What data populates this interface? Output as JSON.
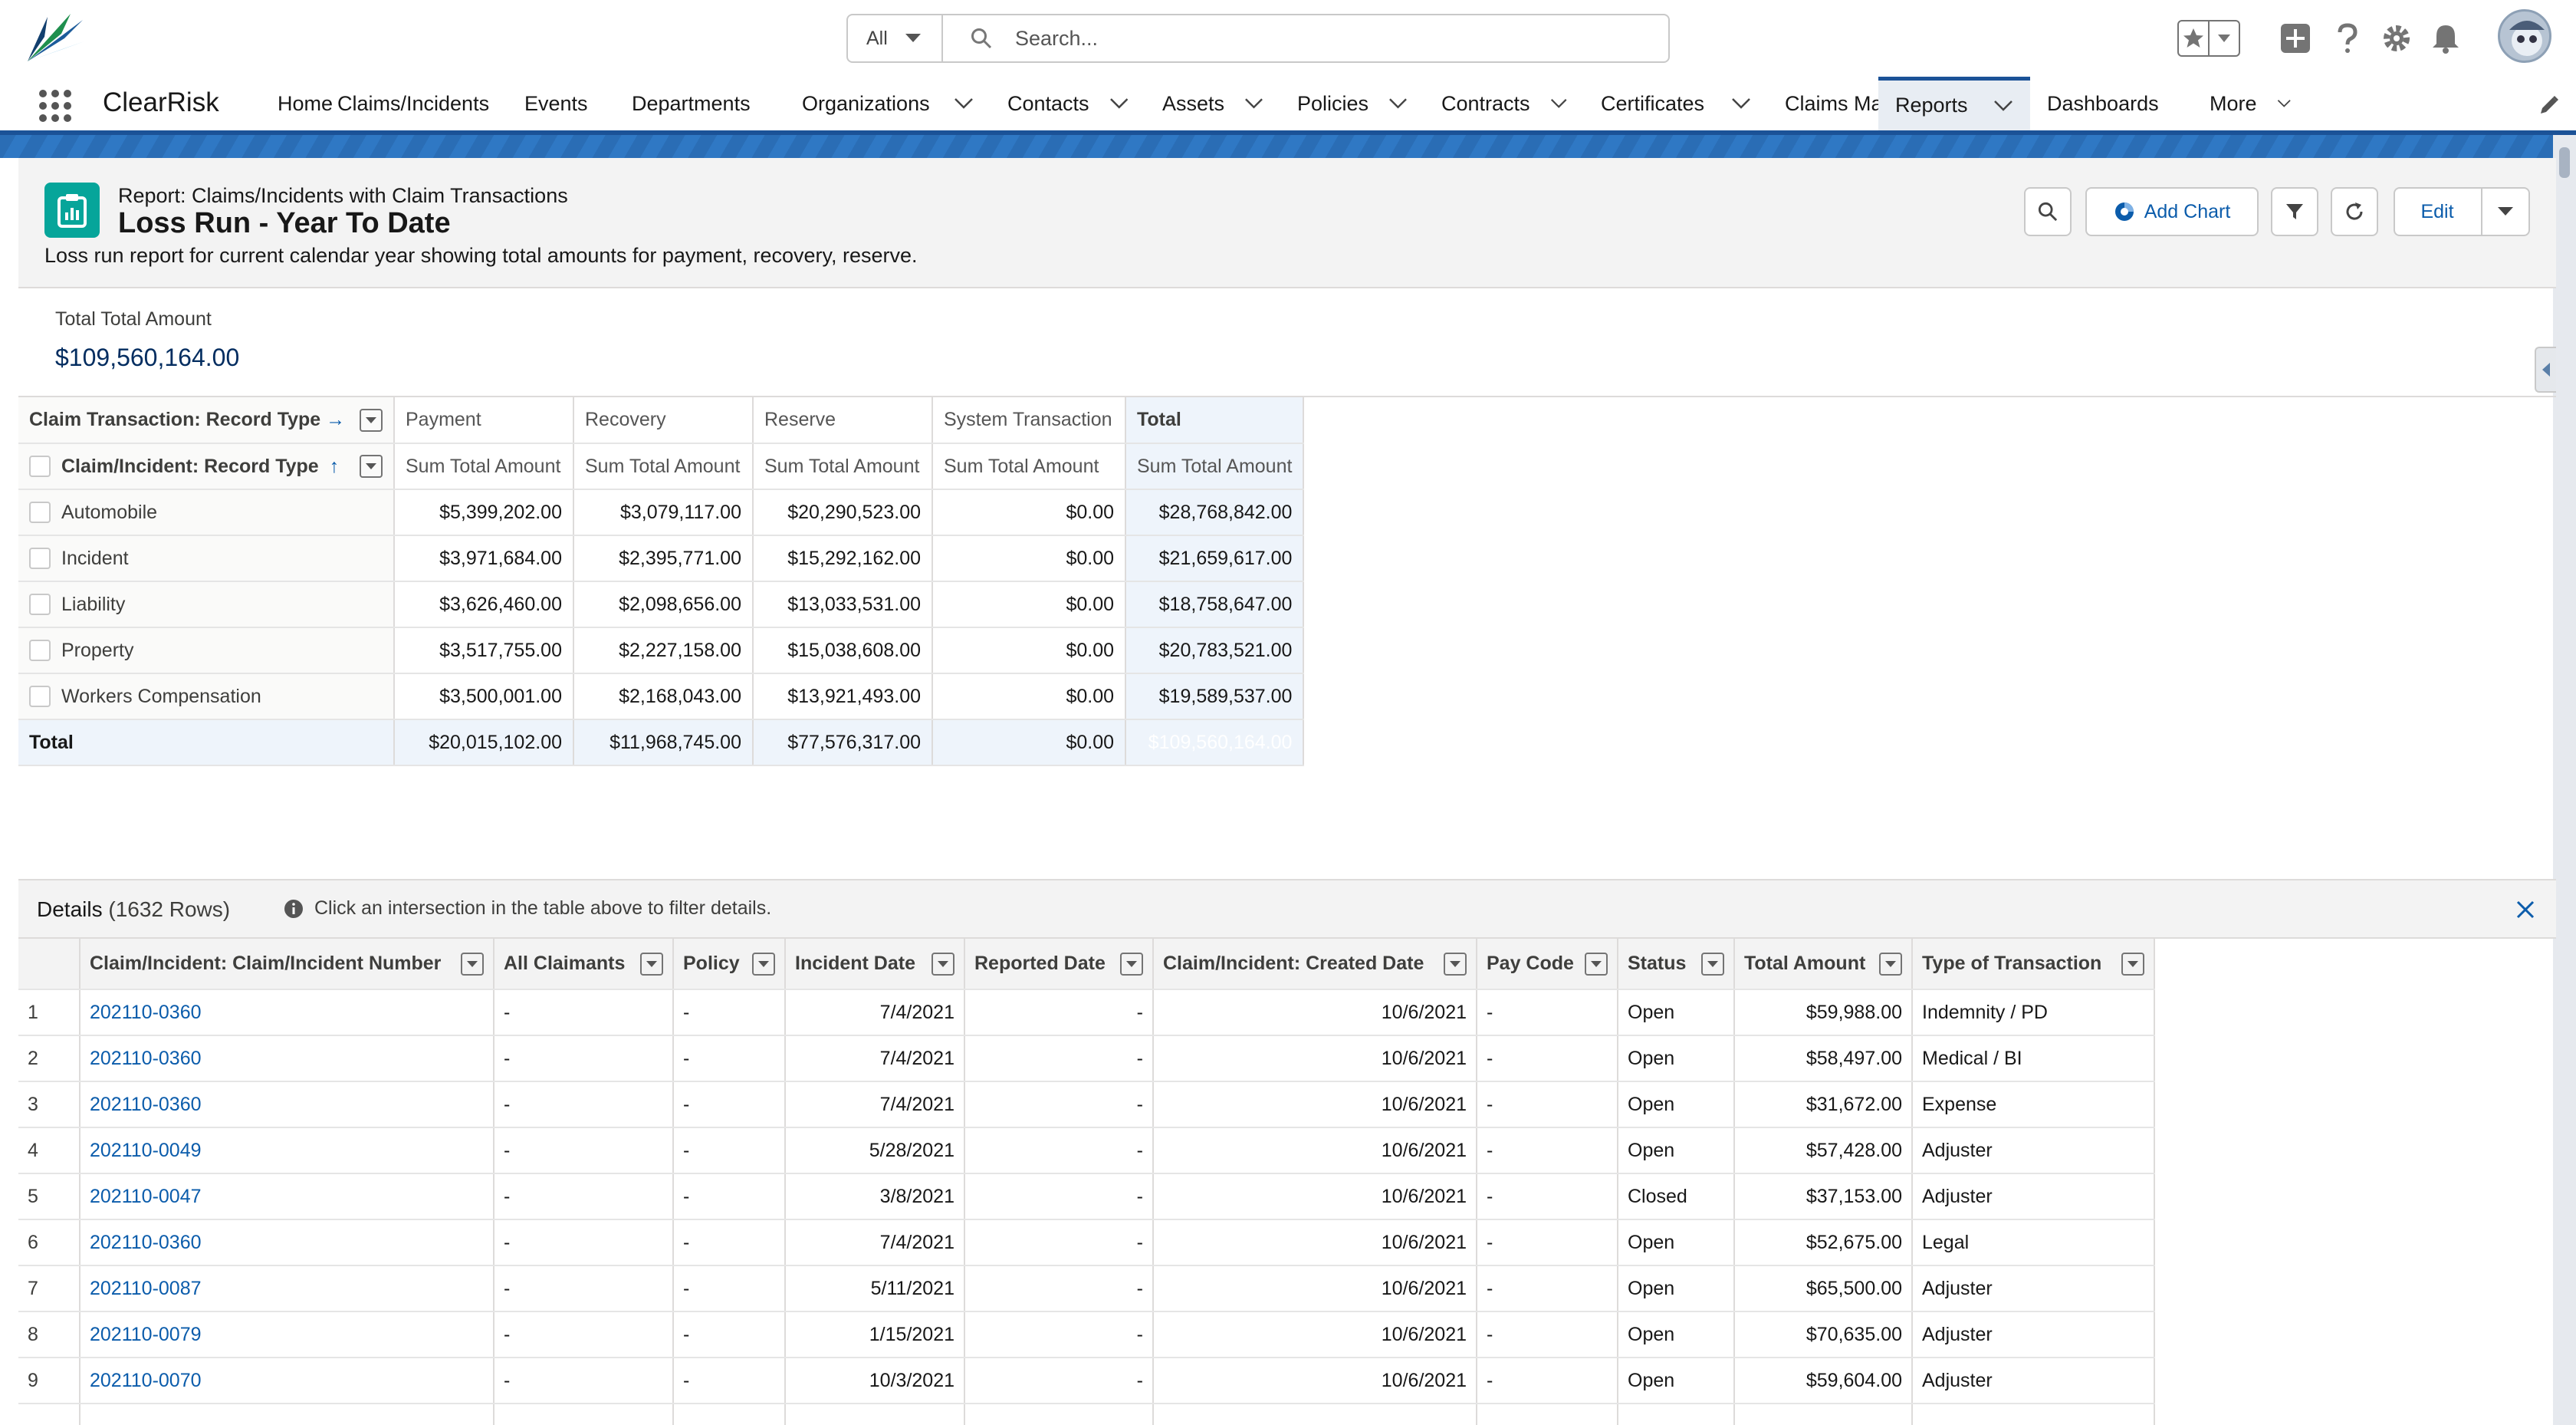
{
  "search": {
    "scope": "All",
    "placeholder": "Search..."
  },
  "app": {
    "name": "ClearRisk"
  },
  "nav": [
    {
      "label": "Home",
      "chevron": false,
      "active": false
    },
    {
      "label": "Claims/Incidents",
      "chevron": true,
      "active": false
    },
    {
      "label": "Events",
      "chevron": true,
      "active": false
    },
    {
      "label": "Departments",
      "chevron": true,
      "active": false
    },
    {
      "label": "Organizations",
      "chevron": true,
      "active": false
    },
    {
      "label": "Contacts",
      "chevron": true,
      "active": false
    },
    {
      "label": "Assets",
      "chevron": true,
      "active": false
    },
    {
      "label": "Policies",
      "chevron": true,
      "active": false
    },
    {
      "label": "Contracts",
      "chevron": true,
      "active": false
    },
    {
      "label": "Certificates",
      "chevron": true,
      "active": false
    },
    {
      "label": "Claims Map",
      "chevron": false,
      "active": false
    },
    {
      "label": "Reports",
      "chevron": true,
      "active": true
    },
    {
      "label": "Dashboards",
      "chevron": true,
      "active": false
    },
    {
      "label": "More",
      "chevron": true,
      "active": false
    }
  ],
  "report": {
    "type_label": "Report: Claims/Incidents with Claim Transactions",
    "title": "Loss Run - Year To Date",
    "description": "Loss run report for current calendar year showing total amounts for payment, recovery, reserve.",
    "add_chart_label": "Add Chart",
    "edit_label": "Edit"
  },
  "summary": {
    "label": "Total Total Amount",
    "value": "$109,560,164.00"
  },
  "matrix": {
    "col_group_label": "Claim Transaction: Record Type",
    "row_group_label": "Claim/Incident: Record Type",
    "columns": [
      "Payment",
      "Recovery",
      "Reserve",
      "System Transaction",
      "Total"
    ],
    "sub_header": "Sum Total Amount",
    "rows": [
      {
        "label": "Automobile",
        "values": [
          "$5,399,202.00",
          "$3,079,117.00",
          "$20,290,523.00",
          "$0.00",
          "$28,768,842.00"
        ]
      },
      {
        "label": "Incident",
        "values": [
          "$3,971,684.00",
          "$2,395,771.00",
          "$15,292,162.00",
          "$0.00",
          "$21,659,617.00"
        ]
      },
      {
        "label": "Liability",
        "values": [
          "$3,626,460.00",
          "$2,098,656.00",
          "$13,033,531.00",
          "$0.00",
          "$18,758,647.00"
        ]
      },
      {
        "label": "Property",
        "values": [
          "$3,517,755.00",
          "$2,227,158.00",
          "$15,038,608.00",
          "$0.00",
          "$20,783,521.00"
        ]
      },
      {
        "label": "Workers Compensation",
        "values": [
          "$3,500,001.00",
          "$2,168,043.00",
          "$13,921,493.00",
          "$0.00",
          "$19,589,537.00"
        ]
      }
    ],
    "total": {
      "label": "Total",
      "values": [
        "$20,015,102.00",
        "$11,968,745.00",
        "$77,576,317.00",
        "$0.00",
        "$109,560,164.00"
      ]
    }
  },
  "details": {
    "title": "Details",
    "count": "(1632 Rows)",
    "hint": "Click an intersection in the table above to filter details.",
    "columns": [
      "Claim/Incident: Claim/Incident Number",
      "All Claimants",
      "Policy",
      "Incident Date",
      "Reported Date",
      "Claim/Incident: Created Date",
      "Pay Code",
      "Status",
      "Total Amount",
      "Type of Transaction"
    ],
    "rows": [
      [
        "1",
        "202110-0360",
        "-",
        "-",
        "7/4/2021",
        "-",
        "10/6/2021",
        "-",
        "Open",
        "$59,988.00",
        "Indemnity / PD"
      ],
      [
        "2",
        "202110-0360",
        "-",
        "-",
        "7/4/2021",
        "-",
        "10/6/2021",
        "-",
        "Open",
        "$58,497.00",
        "Medical / BI"
      ],
      [
        "3",
        "202110-0360",
        "-",
        "-",
        "7/4/2021",
        "-",
        "10/6/2021",
        "-",
        "Open",
        "$31,672.00",
        "Expense"
      ],
      [
        "4",
        "202110-0049",
        "-",
        "-",
        "5/28/2021",
        "-",
        "10/6/2021",
        "-",
        "Open",
        "$57,428.00",
        "Adjuster"
      ],
      [
        "5",
        "202110-0047",
        "-",
        "-",
        "3/8/2021",
        "-",
        "10/6/2021",
        "-",
        "Closed",
        "$37,153.00",
        "Adjuster"
      ],
      [
        "6",
        "202110-0360",
        "-",
        "-",
        "7/4/2021",
        "-",
        "10/6/2021",
        "-",
        "Open",
        "$52,675.00",
        "Legal"
      ],
      [
        "7",
        "202110-0087",
        "-",
        "-",
        "5/11/2021",
        "-",
        "10/6/2021",
        "-",
        "Open",
        "$65,500.00",
        "Adjuster"
      ],
      [
        "8",
        "202110-0079",
        "-",
        "-",
        "1/15/2021",
        "-",
        "10/6/2021",
        "-",
        "Open",
        "$70,635.00",
        "Adjuster"
      ],
      [
        "9",
        "202110-0070",
        "-",
        "-",
        "10/3/2021",
        "-",
        "10/6/2021",
        "-",
        "Open",
        "$59,604.00",
        "Adjuster"
      ]
    ]
  },
  "colors": {
    "brand": "#1b5297",
    "link": "#0b5cab",
    "highlight": "#0176d3",
    "report_icon": "#06a59a"
  },
  "icons": [
    "clearrisk-logo",
    "search-icon",
    "favorite-star-icon",
    "add-icon",
    "help-icon",
    "gear-icon",
    "bell-icon",
    "app-launcher-icon",
    "edit-pencil-icon",
    "report-icon",
    "filter-icon",
    "refresh-icon",
    "info-icon",
    "close-icon"
  ]
}
